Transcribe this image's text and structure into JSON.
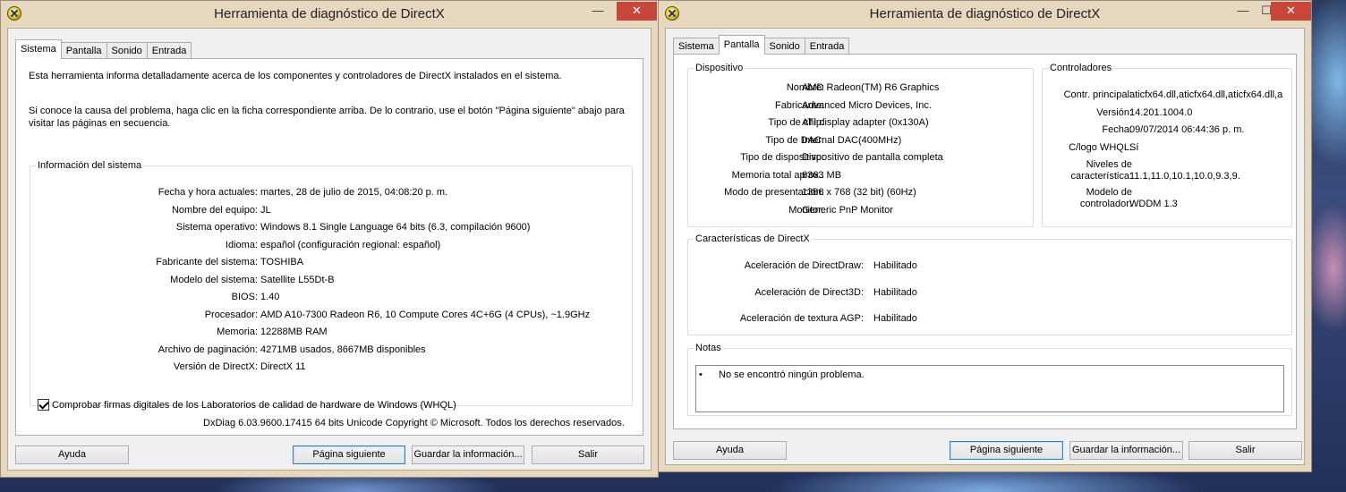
{
  "left_window": {
    "title": "Herramienta de diagnóstico de DirectX",
    "controls": {
      "minimize": "—",
      "maximize": "☐",
      "close": "✕"
    },
    "tabs": [
      "Sistema",
      "Pantalla",
      "Sonido",
      "Entrada"
    ],
    "active_tab": "Sistema",
    "intro_1": "Esta herramienta informa detalladamente acerca de los componentes y controladores de DirectX instalados en el sistema.",
    "intro_2": "Si conoce la causa del problema, haga clic en la ficha correspondiente arriba. De lo contrario, use el botón \"Página siguiente\" abajo para visitar las páginas en secuencia.",
    "sysinfo": {
      "legend": "Información del sistema",
      "rows": [
        {
          "label": "Fecha y hora actuales:",
          "value": "martes, 28 de julio de 2015, 04:08:20 p. m."
        },
        {
          "label": "Nombre del equipo:",
          "value": "JL"
        },
        {
          "label": "Sistema operativo:",
          "value": "Windows 8.1 Single Language 64 bits (6.3, compilación 9600)"
        },
        {
          "label": "Idioma:",
          "value": "español (configuración regional: español)"
        },
        {
          "label": "Fabricante del sistema:",
          "value": "TOSHIBA"
        },
        {
          "label": "Modelo del sistema:",
          "value": "Satellite L55Dt-B"
        },
        {
          "label": "BIOS:",
          "value": "1.40"
        },
        {
          "label": "Procesador:",
          "value": "AMD A10-7300 Radeon R6, 10 Compute Cores 4C+6G  (4 CPUs), ~1.9GHz"
        },
        {
          "label": "Memoria:",
          "value": "12288MB RAM"
        },
        {
          "label": "Archivo de paginación:",
          "value": "4271MB usados, 8667MB disponibles"
        },
        {
          "label": "Versión de DirectX:",
          "value": "DirectX 11"
        }
      ],
      "whql_label": "Comprobar firmas digitales de los Laboratorios de calidad de hardware de Windows (WHQL)",
      "whql_checked": true
    },
    "footer": "DxDiag 6.03.9600.17415 64 bits Unicode  Copyright © Microsoft. Todos los derechos reservados.",
    "buttons": {
      "help": "Ayuda",
      "next": "Página siguiente",
      "save": "Guardar la información...",
      "exit": "Salir"
    }
  },
  "right_window": {
    "title": "Herramienta de diagnóstico de DirectX",
    "controls": {
      "minimize": "—",
      "maximize": "☐",
      "close": "✕"
    },
    "tabs": [
      "Sistema",
      "Pantalla",
      "Sonido",
      "Entrada"
    ],
    "active_tab": "Pantalla",
    "device": {
      "legend": "Dispositivo",
      "rows": [
        {
          "label": "Nombre:",
          "value": "AMD Radeon(TM) R6 Graphics"
        },
        {
          "label": "Fabricante:",
          "value": "Advanced Micro Devices, Inc."
        },
        {
          "label": "Tipo de chip:",
          "value": "ATI display adapter (0x130A)"
        },
        {
          "label": "Tipo de DAC:",
          "value": "Internal DAC(400MHz)"
        },
        {
          "label": "Tipo de dispositivo:",
          "value": "Dispositivo de pantalla completa"
        },
        {
          "label": "Memoria total aprox.:",
          "value": "6363 MB"
        },
        {
          "label": "Modo de presentación:",
          "value": "1366 x 768 (32 bit) (60Hz)"
        },
        {
          "label": "Monitor:",
          "value": "Generic PnP Monitor"
        }
      ]
    },
    "drivers": {
      "legend": "Controladores",
      "rows": [
        {
          "label": "Contr. principal:",
          "value": "aticfx64.dll,aticfx64.dll,aticfx64.dll,a"
        },
        {
          "label": "Versión:",
          "value": "14.201.1004.0"
        },
        {
          "label": "Fecha:",
          "value": "09/07/2014 06:44:36 p. m."
        },
        {
          "label": "C/logo WHQL:",
          "value": "Sí"
        },
        {
          "label_1": "Niveles de",
          "label_2": "característica:",
          "value": "11.1,11.0,10.1,10.0,9.3,9."
        },
        {
          "label_1": "Modelo de",
          "label_2": "controlador:",
          "value": "WDDM 1.3"
        }
      ]
    },
    "directx_features": {
      "legend": "Características de DirectX",
      "rows": [
        {
          "label": "Aceleración de DirectDraw:",
          "value": "Habilitado"
        },
        {
          "label": "Aceleración de Direct3D:",
          "value": "Habilitado"
        },
        {
          "label": "Aceleración de textura AGP:",
          "value": "Habilitado"
        }
      ]
    },
    "notes": {
      "legend": "Notas",
      "bullet": "•",
      "text": "No se encontró ningún problema."
    },
    "buttons": {
      "help": "Ayuda",
      "next": "Página siguiente",
      "save": "Guardar la información...",
      "exit": "Salir"
    }
  }
}
